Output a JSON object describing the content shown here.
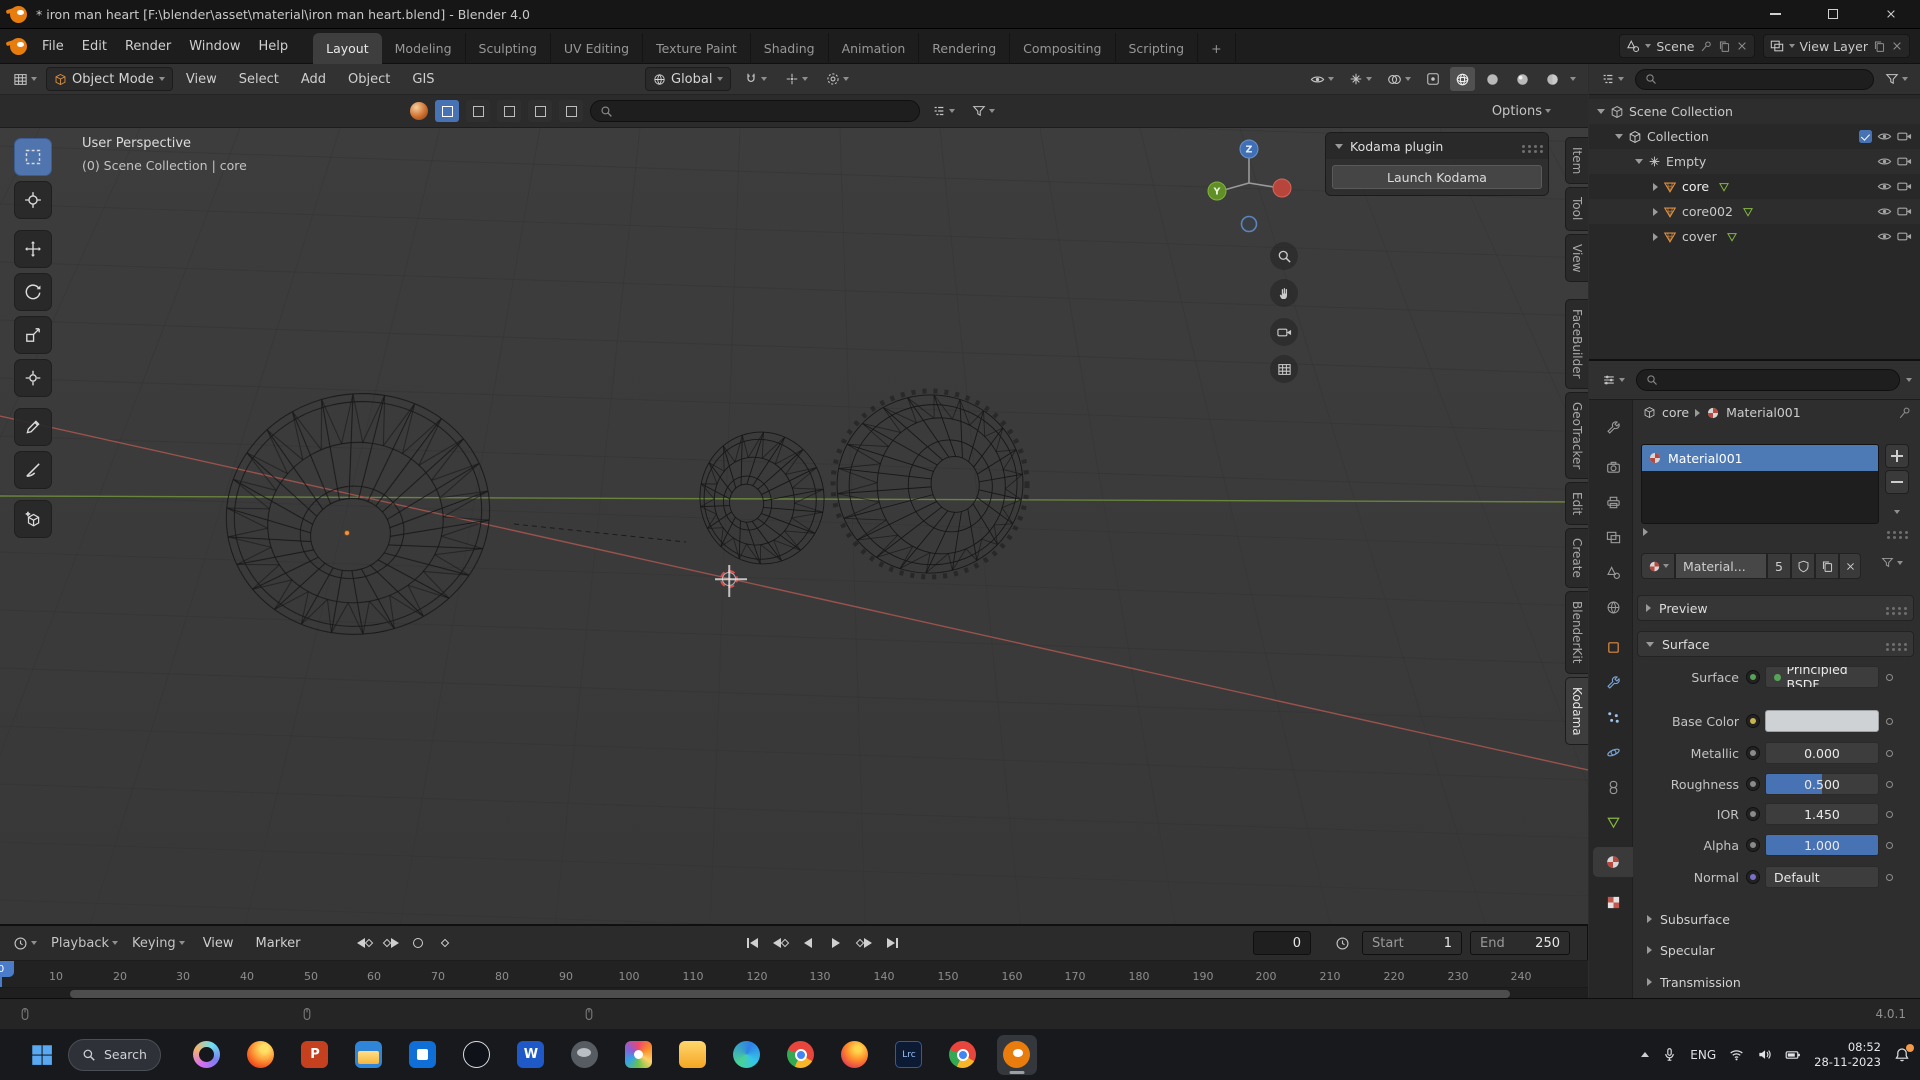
{
  "window": {
    "title": "* iron man heart [F:\\blender\\asset\\material\\iron man heart.blend] - Blender 4.0"
  },
  "topbar": {
    "menus": [
      "File",
      "Edit",
      "Render",
      "Window",
      "Help"
    ],
    "workspaces": [
      "Layout",
      "Modeling",
      "Sculpting",
      "UV Editing",
      "Texture Paint",
      "Shading",
      "Animation",
      "Rendering",
      "Compositing",
      "Scripting"
    ],
    "add_workspace": "+",
    "scene": {
      "label": "Scene"
    },
    "view_layer": {
      "label": "View Layer"
    }
  },
  "viewport": {
    "header": {
      "mode": "Object Mode",
      "menus": [
        "View",
        "Select",
        "Add",
        "Object",
        "GIS"
      ],
      "orientation": "Global",
      "options": "Options"
    },
    "overlay": {
      "perspective": "User Perspective",
      "context": "(0) Scene Collection | core"
    },
    "axis": {
      "z": "Z",
      "y": "Y"
    },
    "kodama": {
      "title": "Kodama plugin",
      "button": "Launch Kodama"
    },
    "side_tabs": [
      "Item",
      "Tool",
      "View",
      "FaceBuilder",
      "GeoTracker",
      "Edit",
      "Create",
      "BlenderKit",
      "Kodama"
    ]
  },
  "outliner": {
    "rows": [
      {
        "label": "Scene Collection"
      },
      {
        "label": "Collection"
      },
      {
        "label": "Empty"
      },
      {
        "label": "core"
      },
      {
        "label": "core002"
      },
      {
        "label": "cover"
      }
    ]
  },
  "properties": {
    "breadcrumb": {
      "object": "core",
      "material": "Material001"
    },
    "slot": "Material001",
    "material_name": "Material...",
    "users": "5",
    "sections": {
      "preview": "Preview",
      "surface": "Surface"
    },
    "surface": {
      "rows": [
        {
          "label": "Surface",
          "value": "Principled BSDF"
        },
        {
          "label": "Base Color",
          "value": ""
        },
        {
          "label": "Metallic",
          "value": "0.000"
        },
        {
          "label": "Roughness",
          "value": "0.500"
        },
        {
          "label": "IOR",
          "value": "1.450"
        },
        {
          "label": "Alpha",
          "value": "1.000"
        },
        {
          "label": "Normal",
          "value": "Default"
        }
      ],
      "collapsed": [
        "Subsurface",
        "Specular",
        "Transmission"
      ]
    }
  },
  "timeline": {
    "menus": [
      "Playback",
      "Keying",
      "View",
      "Marker"
    ],
    "frame": "0",
    "start": {
      "label": "Start",
      "value": "1"
    },
    "end": {
      "label": "End",
      "value": "250"
    },
    "ticks": [
      "10",
      "20",
      "30",
      "40",
      "50",
      "60",
      "70",
      "80",
      "90",
      "100",
      "110",
      "120",
      "130",
      "140",
      "150",
      "160",
      "170",
      "180",
      "190",
      "200",
      "210",
      "220",
      "230",
      "240"
    ]
  },
  "statusbar": {
    "version": "4.0.1"
  },
  "taskbar": {
    "search": "Search",
    "apps": [
      {
        "name": "copilot",
        "label": ""
      },
      {
        "name": "firefox",
        "label": ""
      },
      {
        "name": "powerpoint",
        "label": "P"
      },
      {
        "name": "file-explorer",
        "label": ""
      },
      {
        "name": "store",
        "label": ""
      },
      {
        "name": "obs",
        "label": ""
      },
      {
        "name": "word",
        "label": "W"
      },
      {
        "name": "gimp",
        "label": ""
      },
      {
        "name": "photos",
        "label": ""
      },
      {
        "name": "files",
        "label": ""
      },
      {
        "name": "edge",
        "label": ""
      },
      {
        "name": "chrome",
        "label": ""
      },
      {
        "name": "firefox-dev",
        "label": ""
      },
      {
        "name": "lightroom",
        "label": "Lrc"
      },
      {
        "name": "chrome-alt",
        "label": ""
      },
      {
        "name": "blender",
        "label": ""
      }
    ],
    "tray": {
      "lang": "ENG",
      "time": "08:52",
      "date": "28-11-2023"
    }
  }
}
